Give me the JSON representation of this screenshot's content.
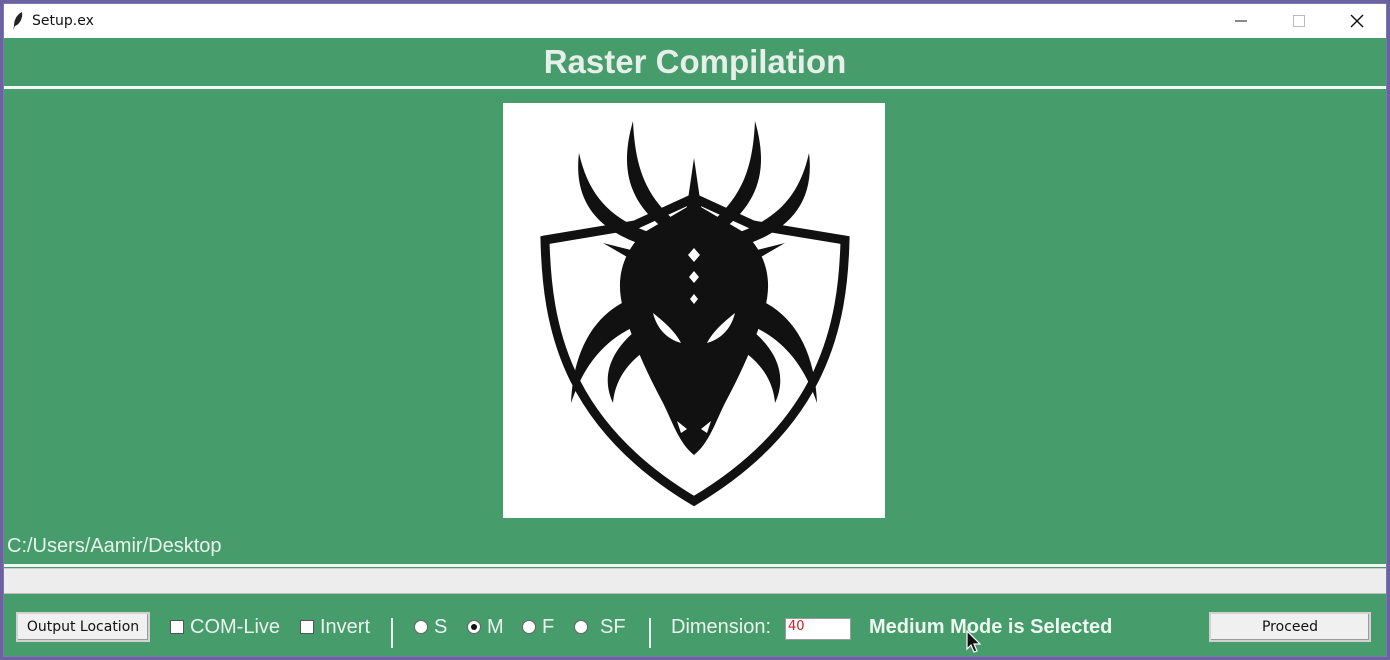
{
  "window": {
    "title": "Setup.ex"
  },
  "header": {
    "title": "Raster Compilation"
  },
  "image": {
    "icon": "dragon-shield-logo"
  },
  "path": {
    "text": "C:/Users/Aamir/Desktop"
  },
  "controls": {
    "output_label": "Output Location",
    "checkboxes": [
      {
        "label": "COM-Live",
        "checked": false
      },
      {
        "label": "Invert",
        "checked": false
      }
    ],
    "radios": [
      {
        "label": "S",
        "selected": false
      },
      {
        "label": "M",
        "selected": true
      },
      {
        "label": "F",
        "selected": false
      },
      {
        "label": "SF",
        "selected": false
      }
    ],
    "dimension_label": "Dimension:",
    "dimension_value": "40",
    "mode_status": "Medium Mode is Selected",
    "proceed_label": "Proceed"
  },
  "colors": {
    "background": "#479c6c",
    "accent_text": "#cc2222"
  }
}
